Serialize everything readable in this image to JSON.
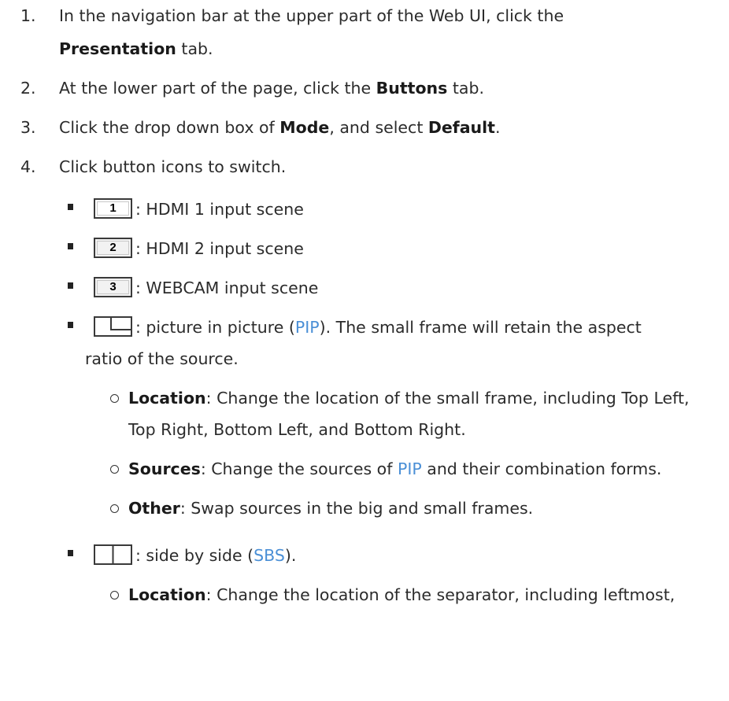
{
  "steps": [
    {
      "num": "1.",
      "parts": [
        "In the navigation bar at the upper part of the Web UI, click the"
      ],
      "line2_bold": "Presentation",
      "line2_rest": " tab."
    },
    {
      "num": "2.",
      "pre": "At the lower part of the page, click the ",
      "bold": "Buttons",
      "post": " tab."
    },
    {
      "num": "3.",
      "pre": "Click the drop down box of ",
      "bold1": "Mode",
      "mid": ", and select ",
      "bold2": "Default",
      "post": "."
    },
    {
      "num": "4.",
      "text": "Click button icons to switch."
    }
  ],
  "buttons": [
    {
      "icon": "1",
      "desc": ": HDMI 1 input scene"
    },
    {
      "icon": "2",
      "desc": ": HDMI 2 input scene"
    },
    {
      "icon": "3",
      "desc": ": WEBCAM input scene"
    }
  ],
  "pip": {
    "pre": ": picture in picture (",
    "abbr": "PIP",
    "post": "). The small frame will retain the aspect",
    "line2": "ratio of the source.",
    "options": [
      {
        "label": "Location",
        "text": ": Change the location of the small frame, including Top Left,",
        "text2": "Top Right, Bottom Left, and Bottom Right."
      },
      {
        "label": "Sources",
        "pre": ": Change the sources of ",
        "abbr": "PIP",
        "post": " and their combination forms."
      },
      {
        "label": "Other",
        "text": ": Swap sources in the big and small frames."
      }
    ]
  },
  "sbs": {
    "pre": ": side by side (",
    "abbr": "SBS",
    "post": ").",
    "options": [
      {
        "label": "Location",
        "text": ": Change the location of the separator, including leftmost,"
      }
    ]
  }
}
